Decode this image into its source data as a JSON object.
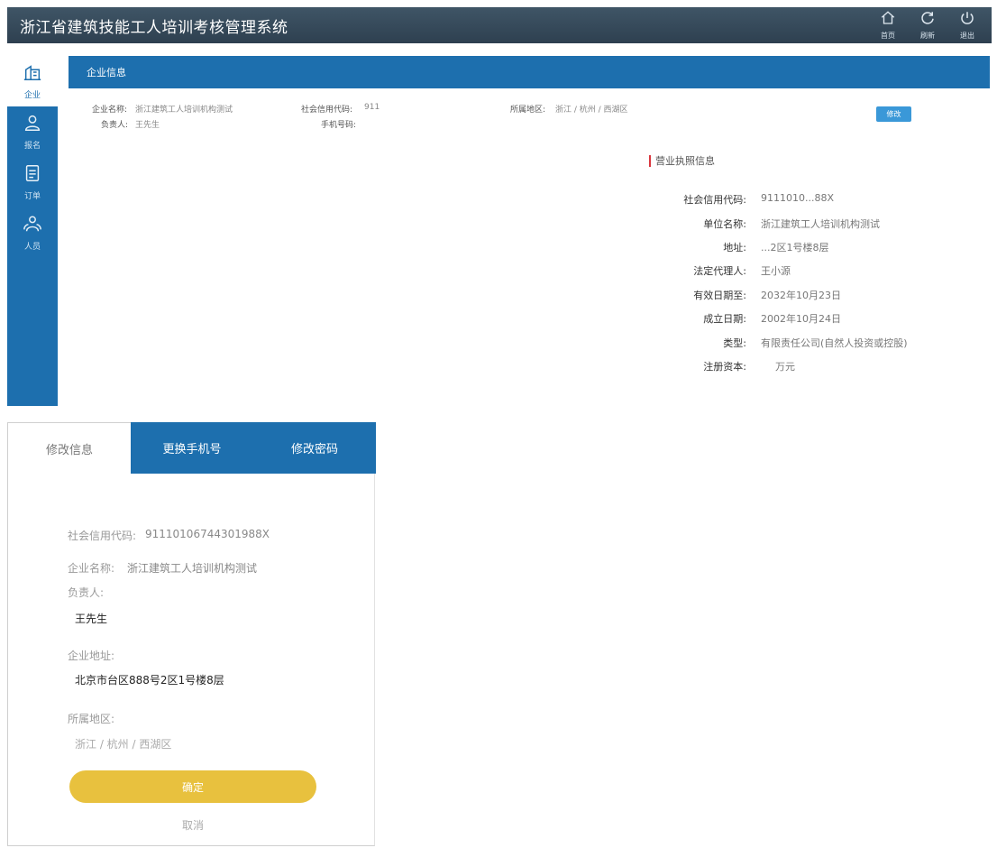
{
  "header": {
    "title": "浙江省建筑技能工人培训考核管理系统",
    "actions": [
      {
        "label": "首页",
        "icon": "home-icon"
      },
      {
        "label": "刷新",
        "icon": "refresh-icon"
      },
      {
        "label": "退出",
        "icon": "power-icon"
      }
    ]
  },
  "sidebar": {
    "items": [
      {
        "label": "企业",
        "icon": "building-icon",
        "active": true
      },
      {
        "label": "报名",
        "icon": "user-icon",
        "active": false
      },
      {
        "label": "订单",
        "icon": "document-icon",
        "active": false
      },
      {
        "label": "人员",
        "icon": "people-icon",
        "active": false
      }
    ]
  },
  "company_panel": {
    "title": "企业信息",
    "fields": {
      "name_label": "企业名称:",
      "name_value": "浙江建筑工人培训机构测试",
      "credit_label": "社会信用代码:",
      "credit_value": "911",
      "region_label": "所属地区:",
      "region_value": "浙江 / 杭州 / 西湖区",
      "owner_label": "负责人:",
      "owner_value": "王先生",
      "phone_label": "手机号码:",
      "phone_value": ""
    },
    "edit_button": "修改"
  },
  "license": {
    "title": "营业执照信息",
    "rows": [
      {
        "label": "社会信用代码:",
        "value": "9111010...88X"
      },
      {
        "label": "单位名称:",
        "value": "浙江建筑工人培训机构测试"
      },
      {
        "label": "地址:",
        "value": "...2区1号楼8层"
      },
      {
        "label": "法定代理人:",
        "value": "王小源"
      },
      {
        "label": "有效日期至:",
        "value": "2032年10月23日"
      },
      {
        "label": "成立日期:",
        "value": "2002年10月24日"
      },
      {
        "label": "类型:",
        "value": "有限责任公司(自然人投资或控股)"
      },
      {
        "label": "注册资本:",
        "value": "万元"
      }
    ]
  },
  "dialog": {
    "tabs": [
      {
        "label": "修改信息",
        "active": true
      },
      {
        "label": "更换手机号",
        "active": false
      },
      {
        "label": "修改密码",
        "active": false
      }
    ],
    "credit_label": "社会信用代码:",
    "credit_value": "91110106744301988X",
    "name_label": "企业名称:",
    "name_value": "浙江建筑工人培训机构测试",
    "owner_label": "负责人:",
    "owner_input": "王先生",
    "address_label": "企业地址:",
    "address_input": "北京市台区888号2区1号楼8层",
    "region_label": "所属地区:",
    "region_value": "浙江 / 杭州 / 西湖区",
    "confirm_button": "确定",
    "cancel_link": "取消"
  },
  "colors": {
    "primary_blue": "#1d6fae",
    "header_dark": "#35495a",
    "confirm_yellow": "#e8c13e",
    "accent_red": "#d9363e"
  }
}
